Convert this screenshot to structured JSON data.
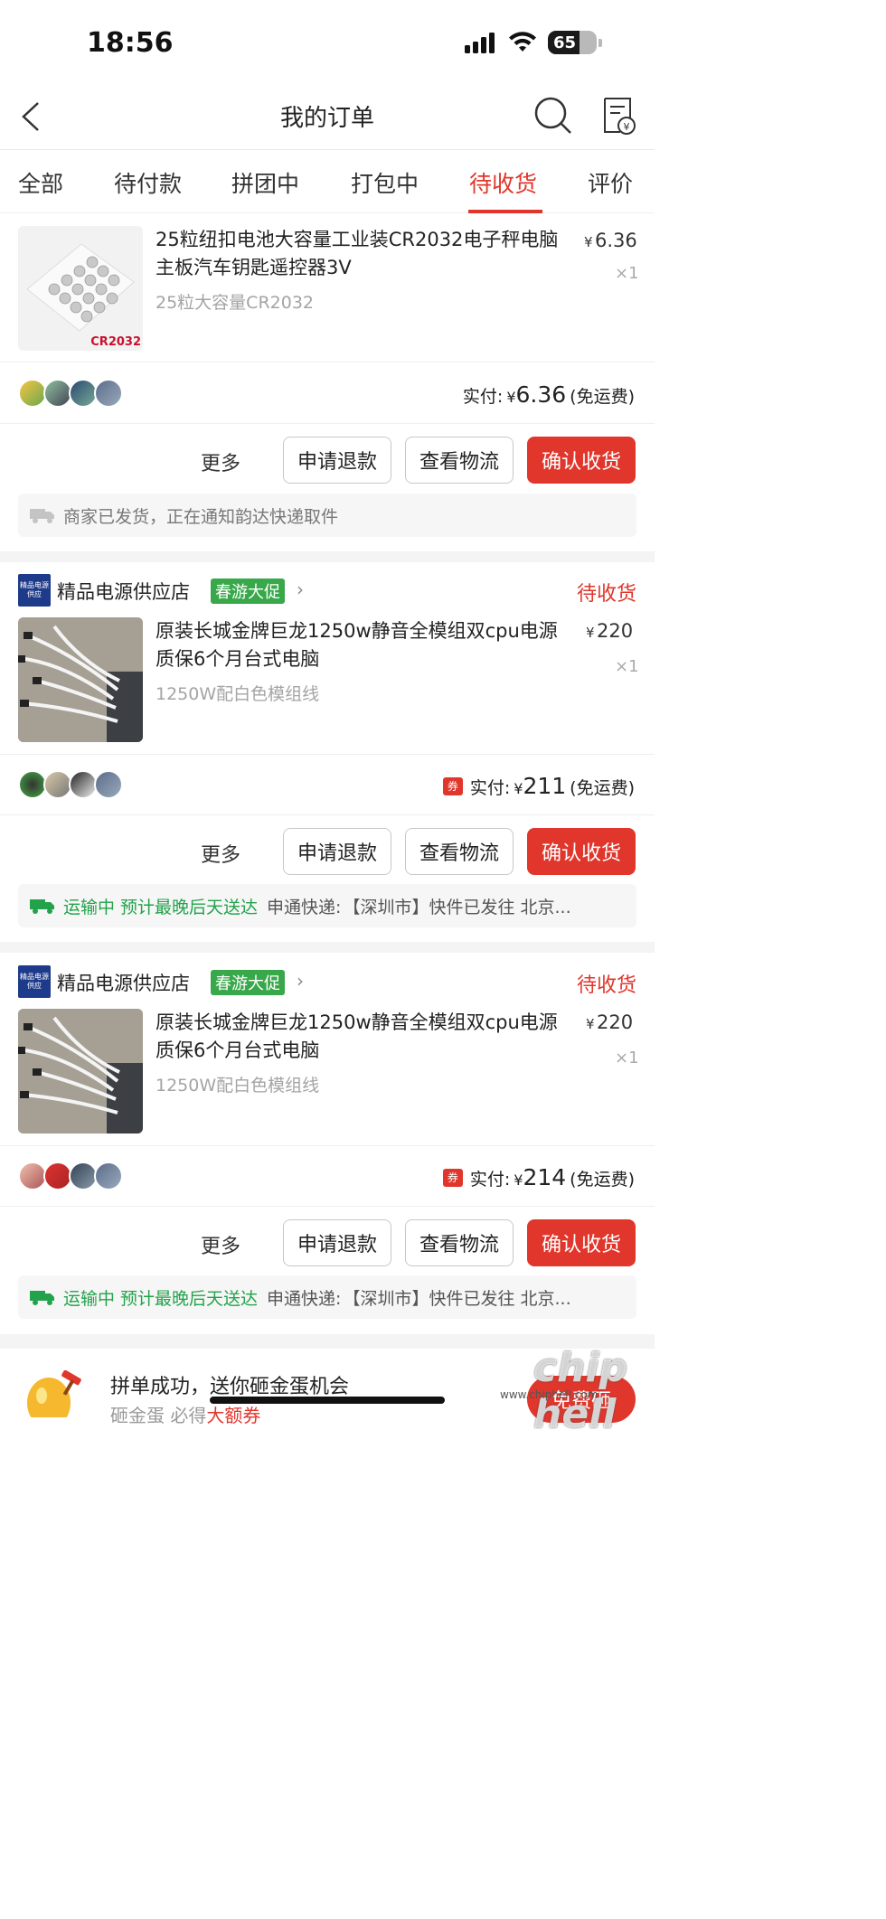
{
  "status_bar": {
    "time": "18:56",
    "battery": "65",
    "battery_level": 0.65
  },
  "navbar": {
    "title": "我的订单",
    "back_icon": "chevron-left-icon",
    "search_icon": "search-icon",
    "receipt_icon": "receipt-icon"
  },
  "tabs": [
    {
      "label": "全部"
    },
    {
      "label": "待付款"
    },
    {
      "label": "拼团中"
    },
    {
      "label": "打包中"
    },
    {
      "label": "待收货",
      "active": true
    },
    {
      "label": "评价"
    }
  ],
  "orders": [
    {
      "product_title": "25粒纽扣电池大容量工业装CR2032电子秤电脑主板汽车钥匙遥控器3V",
      "spec": "25粒大容量CR2032",
      "thumb_label": "CR2032",
      "price_symbol": "¥",
      "price": "6.36",
      "qty": "×1",
      "paid_label": "实付:",
      "paid_symbol": "¥",
      "paid_amount": "6.36",
      "shipping": "(免运费)",
      "actions": {
        "more": "更多",
        "refund": "申请退款",
        "logistics": "查看物流",
        "confirm": "确认收货"
      },
      "logistic_text": "商家已发货，正在通知韵达快递取件"
    },
    {
      "shop_logo": "精品电源供应",
      "shop_name": "精品电源供应店",
      "promo": "春游大促",
      "status": "待收货",
      "product_title": "原装长城金牌巨龙1250w静音全模组双cpu电源质保6个月台式电脑",
      "spec": "1250W配白色模组线",
      "price_symbol": "¥",
      "price": "220",
      "qty": "×1",
      "coupon": "券",
      "paid_label": "实付:",
      "paid_symbol": "¥",
      "paid_amount": "211",
      "shipping": "(免运费)",
      "actions": {
        "more": "更多",
        "refund": "申请退款",
        "logistics": "查看物流",
        "confirm": "确认收货"
      },
      "logistic_status": "运输中 预计最晚后天送达",
      "logistic_carrier": "申通快递:",
      "logistic_detail": "【深圳市】快件已发往 北京..."
    },
    {
      "shop_logo": "精品电源供应",
      "shop_name": "精品电源供应店",
      "promo": "春游大促",
      "status": "待收货",
      "product_title": "原装长城金牌巨龙1250w静音全模组双cpu电源质保6个月台式电脑",
      "spec": "1250W配白色模组线",
      "price_symbol": "¥",
      "price": "220",
      "qty": "×1",
      "coupon": "券",
      "paid_label": "实付:",
      "paid_symbol": "¥",
      "paid_amount": "214",
      "shipping": "(免运费)",
      "actions": {
        "more": "更多",
        "refund": "申请退款",
        "logistics": "查看物流",
        "confirm": "确认收货"
      },
      "logistic_status": "运输中 预计最晚后天送达",
      "logistic_carrier": "申通快递:",
      "logistic_detail": "【深圳市】快件已发往 北京..."
    }
  ],
  "banner": {
    "title": "拼单成功，送你砸金蛋机会",
    "subtitle_prefix": "砸金蛋 必得",
    "subtitle_highlight": "大额券",
    "button": "免费砸"
  },
  "watermark": {
    "logo": "chip hell",
    "url": "www.chiphell.com"
  },
  "colors": {
    "accent": "#e0362c",
    "green": "#22a34b",
    "promo_green": "#38a84a"
  }
}
